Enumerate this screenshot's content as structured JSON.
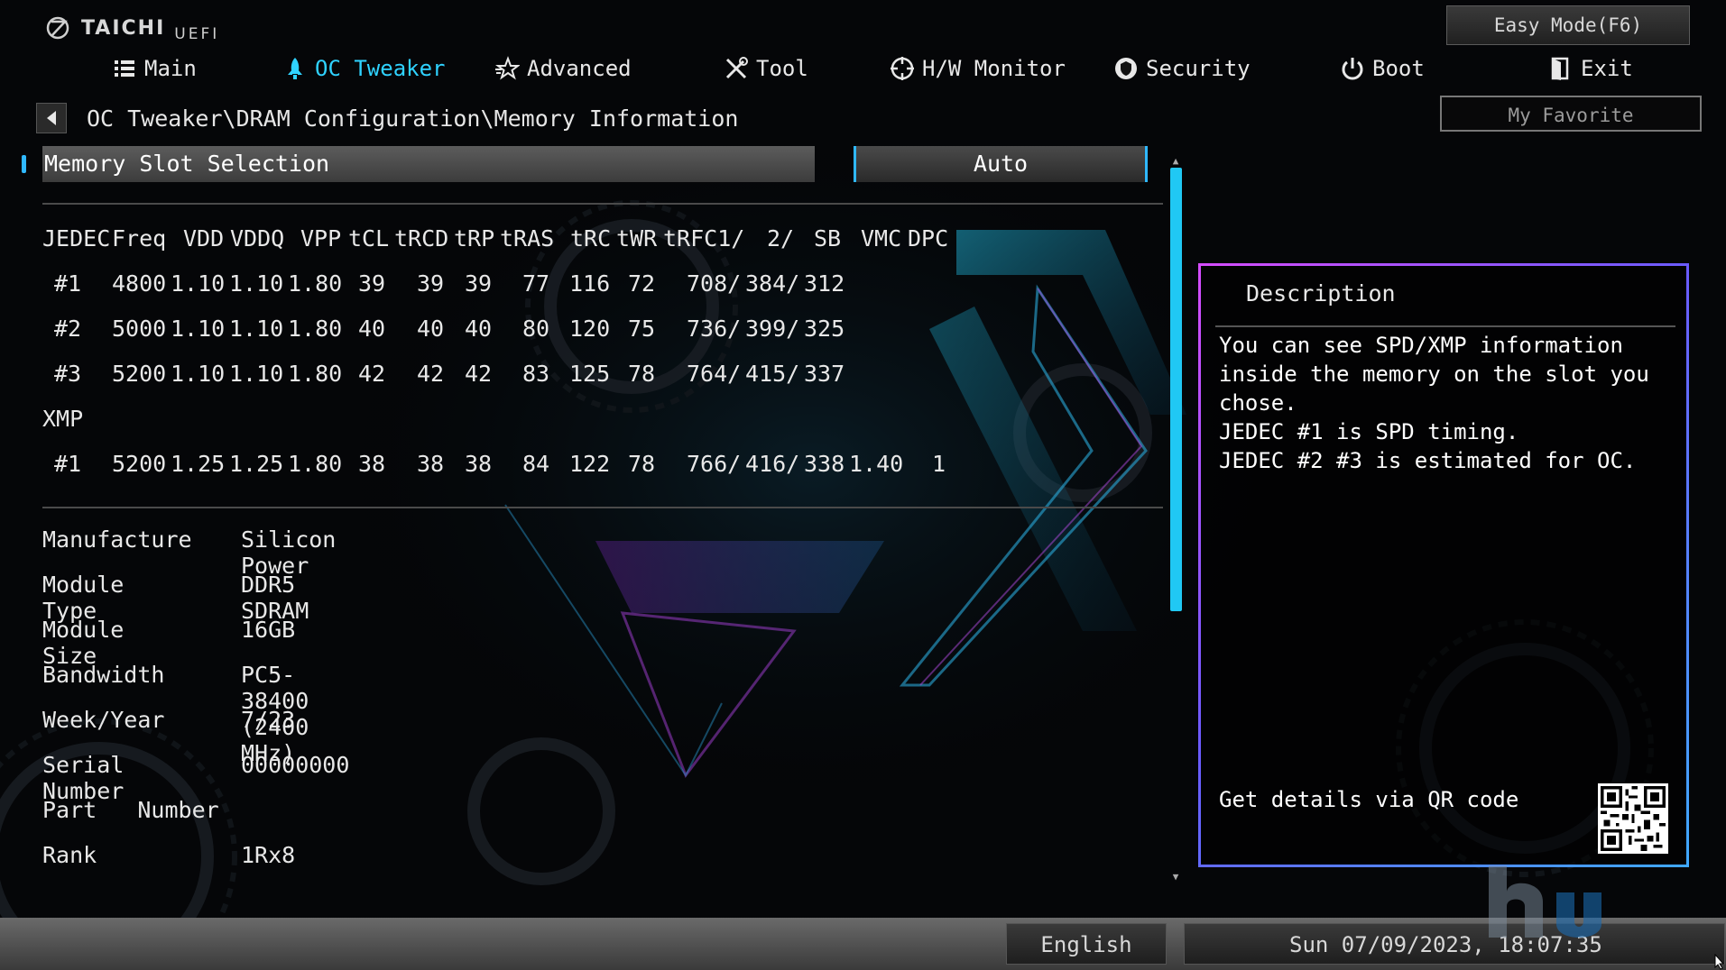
{
  "header": {
    "brand": "TAICHI",
    "uefi": "UEFI",
    "easy_mode": "Easy Mode(F6)",
    "my_favorite": "My Favorite"
  },
  "tabs": [
    {
      "label": "Main",
      "icon": "list-icon"
    },
    {
      "label": "OC Tweaker",
      "icon": "rocket-icon",
      "active": true
    },
    {
      "label": "Advanced",
      "icon": "star-icon"
    },
    {
      "label": "Tool",
      "icon": "tools-icon"
    },
    {
      "label": "H/W Monitor",
      "icon": "crosshair-icon"
    },
    {
      "label": "Security",
      "icon": "shield-icon"
    },
    {
      "label": "Boot",
      "icon": "power-icon"
    },
    {
      "label": "Exit",
      "icon": "exit-icon"
    }
  ],
  "breadcrumb": "OC Tweaker\\DRAM Configuration\\Memory Information",
  "selection": {
    "label": "Memory Slot Selection",
    "value": "Auto"
  },
  "spd": {
    "header": [
      "JEDEC",
      "Freq",
      "VDD",
      "VDDQ",
      "VPP",
      "tCL",
      "tRCD",
      "tRP",
      "tRAS",
      "tRC",
      "tWR",
      "tRFC1/",
      "2/",
      "SB",
      "VMC",
      "DPC"
    ],
    "jedec_rows": [
      [
        "#1",
        "4800",
        "1.10",
        "1.10",
        "1.80",
        "39",
        "39",
        "39",
        "77",
        "116",
        "72",
        "708/",
        "384/",
        "312"
      ],
      [
        "#2",
        "5000",
        "1.10",
        "1.10",
        "1.80",
        "40",
        "40",
        "40",
        "80",
        "120",
        "75",
        "736/",
        "399/",
        "325"
      ],
      [
        "#3",
        "5200",
        "1.10",
        "1.10",
        "1.80",
        "42",
        "42",
        "42",
        "83",
        "125",
        "78",
        "764/",
        "415/",
        "337"
      ]
    ],
    "xmp_label": "XMP",
    "xmp_rows": [
      [
        "#1",
        "5200",
        "1.25",
        "1.25",
        "1.80",
        "38",
        "38",
        "38",
        "84",
        "122",
        "78",
        "766/",
        "416/",
        "338",
        "1.40",
        "1"
      ]
    ]
  },
  "info": [
    {
      "key": "Manufacture",
      "value": "Silicon Power"
    },
    {
      "key": "Module Type",
      "value": "DDR5 SDRAM"
    },
    {
      "key": "Module Size",
      "value": "16GB"
    },
    {
      "key": "Bandwidth",
      "value": "PC5-38400 (2400 MHz)"
    },
    {
      "key": "Week/Year",
      "value": "7/23"
    },
    {
      "key": "Serial Number",
      "value": "00000000"
    },
    {
      "key": "Part   Number",
      "value": ""
    },
    {
      "key": "Rank",
      "value": "1Rx8"
    }
  ],
  "description": {
    "title": "Description",
    "lines": [
      "You can see SPD/XMP information",
      "inside the memory on the slot you",
      "chose.",
      "JEDEC #1 is SPD timing.",
      "JEDEC #2 #3 is estimated for OC."
    ],
    "qr_text": "Get details via QR code"
  },
  "footer": {
    "language": "English",
    "datetime": "Sun 07/09/2023, 18:07:35"
  },
  "colors": {
    "accent": "#2fd2ff",
    "scrollbar": "#20c8f4",
    "panel_border_start": "#d64cff",
    "panel_border_end": "#3fa8ff"
  }
}
